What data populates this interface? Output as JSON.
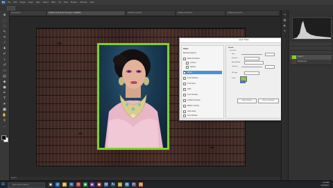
{
  "menubar": {
    "logo": "Ps",
    "items": [
      "File",
      "Edit",
      "Image",
      "Layer",
      "Type",
      "Select",
      "Filter",
      "3D",
      "View",
      "Plugins",
      "Window",
      "Help"
    ]
  },
  "tabs": [
    "stock-photo-...",
    "Untitled-1.psd @ 66.7% (Layer 1, RGB/8#)",
    "Untitled-2 @ 100%",
    "Untitled-3 @ 66.7%",
    "Untitled-4 @ 66.7%"
  ],
  "dialog": {
    "title": "Layer Style",
    "close": "×",
    "styles": [
      "Styles",
      "Blending Options",
      "Bevel & Emboss",
      "Contour",
      "Texture",
      "Stroke",
      "Inner Shadow",
      "Inner Glow",
      "Satin",
      "Color Overlay",
      "Gradient Overlay",
      "Pattern Overlay",
      "Outer Glow",
      "Drop Shadow"
    ],
    "props": {
      "section": "Stroke",
      "structure": "Structure",
      "size_label": "Size:",
      "position_label": "Position:",
      "blend_label": "Blend Mode:",
      "opacity_label": "Opacity:",
      "fill_label": "Fill Type:",
      "color_label": "Color:",
      "make_default": "Make Default",
      "reset_default": "Reset to Default"
    },
    "buttons": [
      "OK",
      "Cancel",
      "New Style...",
      "Preview"
    ]
  },
  "layers": [
    "Layer 1",
    "Background"
  ],
  "status": "66.67%",
  "taskbar": {
    "search": "Type here to search",
    "time": "7:15 PM",
    "date": "1/17/2021"
  },
  "colors": {
    "stroke_green": "#7ed321",
    "selection_blue": "#4a90e2"
  }
}
